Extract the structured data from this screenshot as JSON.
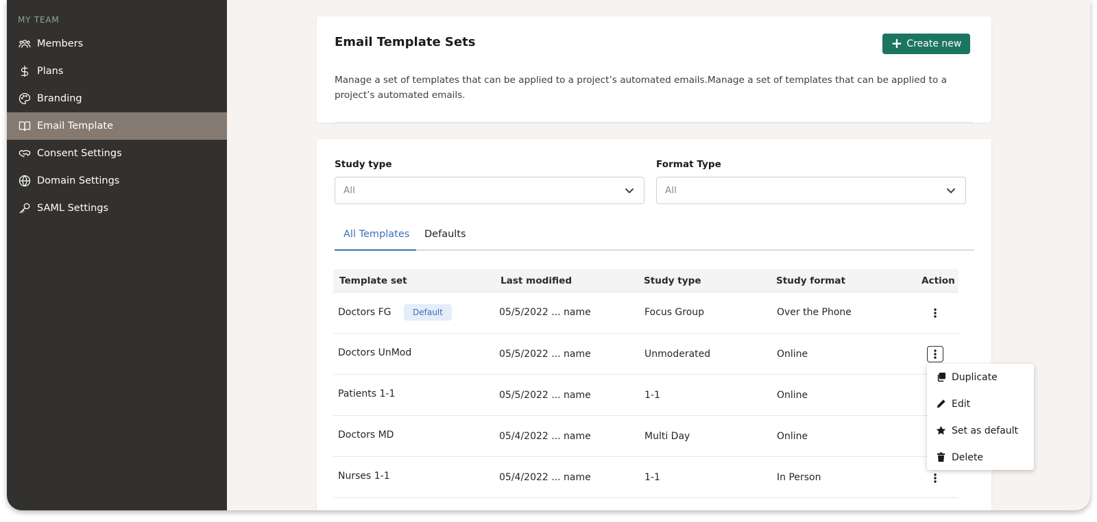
{
  "sidebar": {
    "section_label": "MY TEAM",
    "items": [
      {
        "label": "Members",
        "icon": "users-icon"
      },
      {
        "label": "Plans",
        "icon": "dollar-icon"
      },
      {
        "label": "Branding",
        "icon": "palette-icon"
      },
      {
        "label": "Email Template",
        "icon": "book-icon",
        "active": true
      },
      {
        "label": "Consent Settings",
        "icon": "handshake-icon"
      },
      {
        "label": "Domain Settings",
        "icon": "globe-icon"
      },
      {
        "label": "SAML Settings",
        "icon": "key-icon"
      }
    ]
  },
  "header": {
    "title": "Email Template Sets",
    "create_label": "Create new",
    "description": "Manage a set of templates that can be applied to a project’s automated emails.Manage a set of templates that can be applied to a project’s automated emails."
  },
  "filters": {
    "study_type": {
      "label": "Study type",
      "value": "All"
    },
    "format_type": {
      "label": "Format Type",
      "value": "All"
    }
  },
  "tabs": [
    {
      "label": "All Templates",
      "active": true
    },
    {
      "label": "Defaults",
      "active": false
    }
  ],
  "table": {
    "columns": [
      "Template set",
      "Last modified",
      "Study type",
      "Study format",
      "Action"
    ],
    "rows": [
      {
        "name": "Doctors FG",
        "badge": "Default",
        "modified": "05/5/2022 ... name",
        "study_type": "Focus Group",
        "format": "Over the Phone"
      },
      {
        "name": "Doctors UnMod",
        "modified": "05/5/2022 ... name",
        "study_type": "Unmoderated",
        "format": "Online"
      },
      {
        "name": "Patients 1-1",
        "modified": "05/5/2022 ... name",
        "study_type": "1-1",
        "format": "Online"
      },
      {
        "name": "Doctors MD",
        "modified": "05/4/2022 ... name",
        "study_type": "Multi Day",
        "format": "Online"
      },
      {
        "name": "Nurses 1-1",
        "modified": "05/4/2022 ... name",
        "study_type": "1-1",
        "format": "In Person"
      }
    ]
  },
  "action_menu": {
    "items": [
      {
        "label": "Duplicate",
        "icon": "copy-icon"
      },
      {
        "label": "Edit",
        "icon": "pencil-icon"
      },
      {
        "label": "Set as default",
        "icon": "star-icon"
      },
      {
        "label": "Delete",
        "icon": "trash-icon"
      }
    ]
  },
  "colors": {
    "sidebar_bg": "#33312f",
    "sidebar_active": "#857a72",
    "primary_button": "#1c7560",
    "accent_blue": "#3a6fb5",
    "page_bg": "#f6f3f0"
  }
}
